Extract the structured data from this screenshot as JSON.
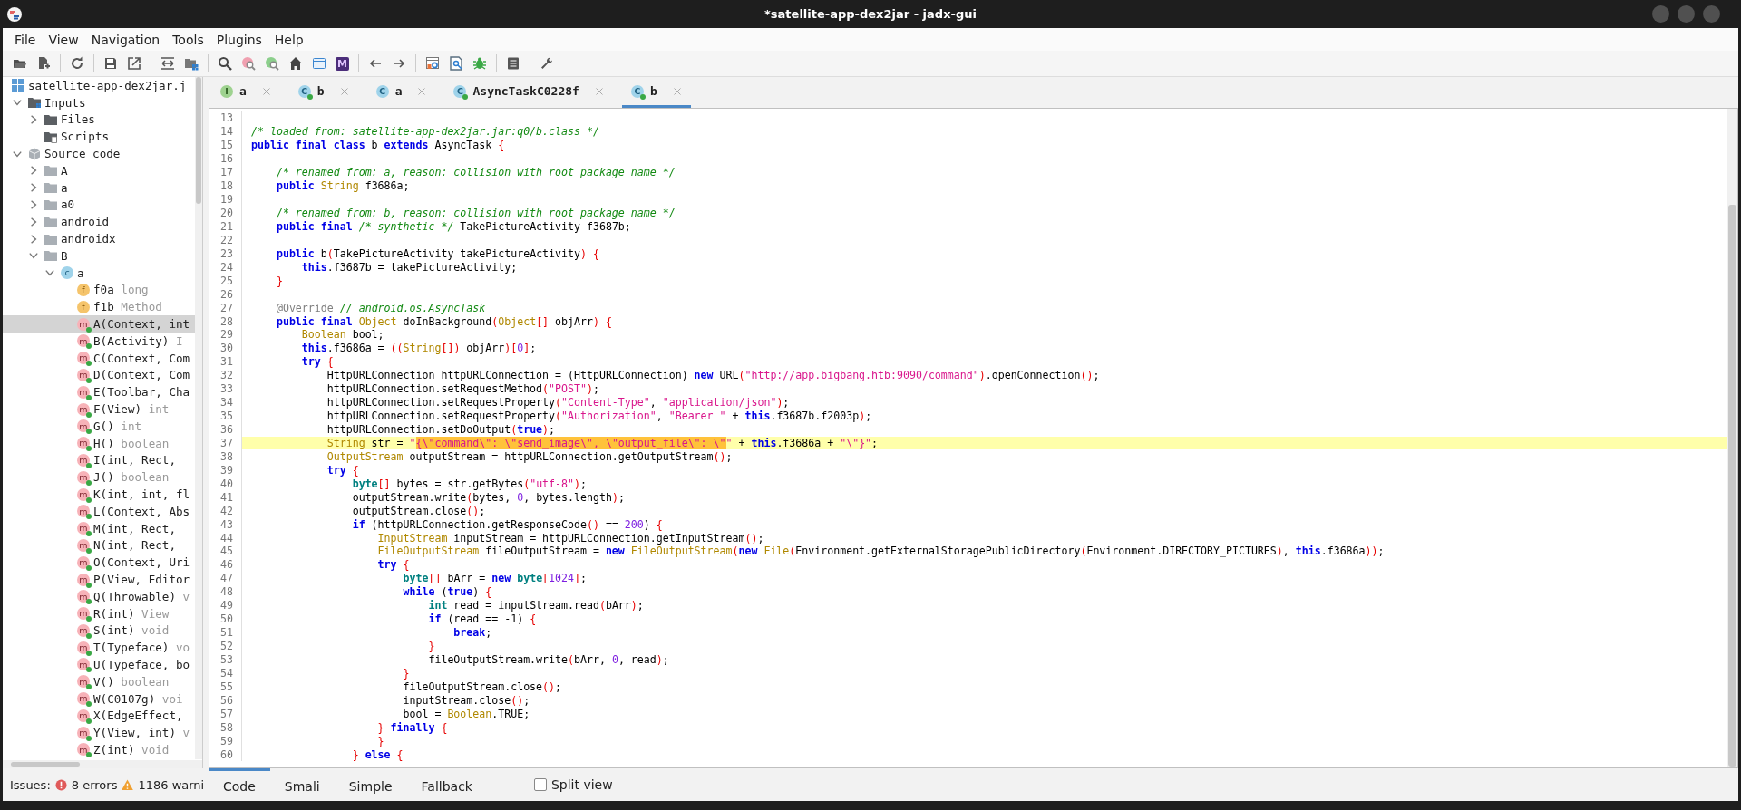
{
  "window": {
    "title": "*satellite-app-dex2jar - jadx-gui"
  },
  "menu": [
    "File",
    "View",
    "Navigation",
    "Tools",
    "Plugins",
    "Help"
  ],
  "toolbar": {
    "mnemonic": "M"
  },
  "tree": [
    {
      "label": "satellite-app-dex2jar.j",
      "kind": "root",
      "selected": false,
      "children": [
        {
          "label": "Inputs",
          "kind": "inputs",
          "expanded": true,
          "selected": false,
          "children": [
            {
              "label": "Files",
              "kind": "folder",
              "expanded": false,
              "selected": false
            },
            {
              "label": "Scripts",
              "kind": "scripts",
              "selected": false
            }
          ]
        },
        {
          "label": "Source code",
          "kind": "source",
          "expanded": true,
          "selected": false,
          "children": [
            {
              "label": "A",
              "kind": "package",
              "expanded": false,
              "selected": false
            },
            {
              "label": "a",
              "kind": "package",
              "expanded": false,
              "selected": false
            },
            {
              "label": "a0",
              "kind": "package",
              "expanded": false,
              "selected": false
            },
            {
              "label": "android",
              "kind": "package",
              "expanded": false,
              "selected": false
            },
            {
              "label": "androidx",
              "kind": "package",
              "expanded": false,
              "selected": false
            },
            {
              "label": "B",
              "kind": "package",
              "expanded": true,
              "selected": false,
              "children": [
                {
                  "label": "a",
                  "kind": "class",
                  "badge": "c",
                  "expanded": true,
                  "selected": false,
                  "children": [
                    {
                      "label": "f0a",
                      "detail": "long",
                      "kind": "field",
                      "badge": "f",
                      "selected": false
                    },
                    {
                      "label": "f1b",
                      "detail": "Method",
                      "kind": "field",
                      "badge": "f",
                      "selected": false
                    },
                    {
                      "label": "A(Context, int",
                      "kind": "method",
                      "badge": "m",
                      "selected": true
                    },
                    {
                      "label": "B(Activity)",
                      "detail": "I",
                      "kind": "method",
                      "badge": "m",
                      "selected": false
                    },
                    {
                      "label": "C(Context, Com",
                      "kind": "method",
                      "badge": "m",
                      "selected": false
                    },
                    {
                      "label": "D(Context, Com",
                      "kind": "method",
                      "badge": "m",
                      "selected": false
                    },
                    {
                      "label": "E(Toolbar, Cha",
                      "kind": "method",
                      "badge": "m",
                      "selected": false
                    },
                    {
                      "label": "F(View)",
                      "detail": "int",
                      "kind": "method",
                      "badge": "m",
                      "selected": false
                    },
                    {
                      "label": "G()",
                      "detail": "int",
                      "kind": "method",
                      "badge": "m",
                      "selected": false
                    },
                    {
                      "label": "H()",
                      "detail": "boolean",
                      "kind": "method",
                      "badge": "m",
                      "selected": false
                    },
                    {
                      "label": "I(int, Rect,",
                      "kind": "method",
                      "badge": "m",
                      "selected": false
                    },
                    {
                      "label": "J()",
                      "detail": "boolean",
                      "kind": "method",
                      "badge": "m",
                      "selected": false
                    },
                    {
                      "label": "K(int, int, fl",
                      "kind": "method",
                      "badge": "m",
                      "selected": false
                    },
                    {
                      "label": "L(Context, Abs",
                      "kind": "method",
                      "badge": "m",
                      "selected": false
                    },
                    {
                      "label": "M(int, Rect,",
                      "kind": "method",
                      "badge": "m",
                      "selected": false
                    },
                    {
                      "label": "N(int, Rect,",
                      "kind": "method",
                      "badge": "m",
                      "selected": false
                    },
                    {
                      "label": "O(Context, Uri",
                      "kind": "method",
                      "badge": "m",
                      "selected": false
                    },
                    {
                      "label": "P(View, Editor",
                      "kind": "method",
                      "badge": "m",
                      "selected": false
                    },
                    {
                      "label": "Q(Throwable)",
                      "detail": "v",
                      "kind": "method",
                      "badge": "m",
                      "selected": false
                    },
                    {
                      "label": "R(int)",
                      "detail": "View",
                      "kind": "method",
                      "badge": "m",
                      "selected": false
                    },
                    {
                      "label": "S(int)",
                      "detail": "void",
                      "kind": "method",
                      "badge": "m",
                      "selected": false
                    },
                    {
                      "label": "T(Typeface)",
                      "detail": "vo",
                      "kind": "method",
                      "badge": "m",
                      "selected": false
                    },
                    {
                      "label": "U(Typeface, bo",
                      "kind": "method",
                      "badge": "m",
                      "selected": false
                    },
                    {
                      "label": "V()",
                      "detail": "boolean",
                      "kind": "method",
                      "badge": "m",
                      "selected": false
                    },
                    {
                      "label": "W(C0107g)",
                      "detail": "voi",
                      "kind": "method",
                      "badge": "m",
                      "selected": false
                    },
                    {
                      "label": "X(EdgeEffect,",
                      "kind": "method",
                      "badge": "m",
                      "selected": false
                    },
                    {
                      "label": "Y(View, int)",
                      "detail": "v",
                      "kind": "method",
                      "badge": "m",
                      "selected": false
                    },
                    {
                      "label": "Z(int)",
                      "detail": "void",
                      "kind": "method",
                      "badge": "m",
                      "selected": false
                    }
                  ]
                }
              ]
            }
          ]
        }
      ]
    }
  ],
  "tabs": [
    {
      "label": "a",
      "kind": "interface",
      "badge": "I",
      "selected": false
    },
    {
      "label": "b",
      "kind": "class-public",
      "badge": "C",
      "selected": false
    },
    {
      "label": "a",
      "kind": "class",
      "badge": "C",
      "selected": false
    },
    {
      "label": "AsyncTaskC0228f",
      "kind": "class-public",
      "badge": "C",
      "selected": false
    },
    {
      "label": "b",
      "kind": "class-public",
      "badge": "C",
      "selected": true
    }
  ],
  "editor": {
    "lines": [
      {
        "num": "13",
        "highlighted": false
      },
      {
        "num": "14",
        "highlighted": false,
        "tokens": [
          {
            "kind": "comment",
            "text": "/* loaded from: satellite-app-dex2jar.jar:q0/b.class */"
          }
        ]
      },
      {
        "num": "15",
        "highlighted": false,
        "tokens": [
          {
            "kind": "keyword",
            "text": "public final class"
          },
          {
            "kind": "plain",
            "text": " b "
          },
          {
            "kind": "keyword",
            "text": "extends"
          },
          {
            "kind": "plain",
            "text": " AsyncTask "
          },
          {
            "kind": "brace",
            "text": "{"
          }
        ]
      },
      {
        "num": "16",
        "highlighted": false
      },
      {
        "num": "17",
        "highlighted": false,
        "tokens": [
          {
            "kind": "comment",
            "text": "    /* renamed from: a, reason: collision with root package name */"
          }
        ]
      },
      {
        "num": "18",
        "highlighted": false,
        "tokens": [
          {
            "kind": "keyword",
            "text": "    public "
          },
          {
            "kind": "type",
            "text": "String"
          },
          {
            "kind": "plain",
            "text": " f3686a;"
          }
        ]
      },
      {
        "num": "19",
        "highlighted": false
      },
      {
        "num": "20",
        "highlighted": false,
        "tokens": [
          {
            "kind": "comment",
            "text": "    /* renamed from: b, reason: collision with root package name */"
          }
        ]
      },
      {
        "num": "21",
        "highlighted": false,
        "tokens": [
          {
            "kind": "keyword",
            "text": "    public final "
          },
          {
            "kind": "comment",
            "text": "/* synthetic */"
          },
          {
            "kind": "plain",
            "text": " TakePictureActivity f3687b;"
          }
        ]
      },
      {
        "num": "22",
        "highlighted": false
      },
      {
        "num": "23",
        "highlighted": false,
        "tokens": [
          {
            "kind": "keyword",
            "text": "    public"
          },
          {
            "kind": "plain",
            "text": " b"
          },
          {
            "kind": "brace",
            "text": "("
          },
          {
            "kind": "plain",
            "text": "TakePictureActivity takePictureActivity"
          },
          {
            "kind": "brace",
            "text": ") {"
          }
        ]
      },
      {
        "num": "24",
        "highlighted": false,
        "tokens": [
          {
            "kind": "keyword",
            "text": "        this"
          },
          {
            "kind": "plain",
            "text": ".f3687b = takePictureActivity;"
          }
        ]
      },
      {
        "num": "25",
        "highlighted": false,
        "tokens": [
          {
            "kind": "brace",
            "text": "    }"
          }
        ]
      },
      {
        "num": "26",
        "highlighted": false
      },
      {
        "num": "27",
        "highlighted": false,
        "tokens": [
          {
            "kind": "annotation",
            "text": "    @Override "
          },
          {
            "kind": "comment",
            "text": "// android.os.AsyncTask"
          }
        ]
      },
      {
        "num": "28",
        "highlighted": false,
        "tokens": [
          {
            "kind": "keyword",
            "text": "    public final "
          },
          {
            "kind": "type",
            "text": "Object"
          },
          {
            "kind": "plain",
            "text": " doInBackground"
          },
          {
            "kind": "brace",
            "text": "("
          },
          {
            "kind": "type",
            "text": "Object"
          },
          {
            "kind": "brace",
            "text": "[]"
          },
          {
            "kind": "plain",
            "text": " objArr"
          },
          {
            "kind": "brace",
            "text": ") {"
          }
        ]
      },
      {
        "num": "29",
        "highlighted": false,
        "tokens": [
          {
            "kind": "type",
            "text": "        Boolean"
          },
          {
            "kind": "plain",
            "text": " bool;"
          }
        ]
      },
      {
        "num": "30",
        "highlighted": false,
        "tokens": [
          {
            "kind": "keyword",
            "text": "        this"
          },
          {
            "kind": "plain",
            "text": ".f3686a = "
          },
          {
            "kind": "brace",
            "text": "(("
          },
          {
            "kind": "type",
            "text": "String"
          },
          {
            "kind": "brace",
            "text": "[])"
          },
          {
            "kind": "plain",
            "text": " objArr"
          },
          {
            "kind": "brace",
            "text": ")["
          },
          {
            "kind": "number",
            "text": "0"
          },
          {
            "kind": "brace",
            "text": "]"
          },
          {
            "kind": "plain",
            "text": ";"
          }
        ]
      },
      {
        "num": "31",
        "highlighted": false,
        "tokens": [
          {
            "kind": "keyword",
            "text": "        try "
          },
          {
            "kind": "brace",
            "text": "{"
          }
        ]
      },
      {
        "num": "32",
        "highlighted": false,
        "tokens": [
          {
            "kind": "plain",
            "text": "            HttpURLConnection httpURLConnection = (HttpURLConnection) "
          },
          {
            "kind": "keyword",
            "text": "new"
          },
          {
            "kind": "plain",
            "text": " URL"
          },
          {
            "kind": "brace",
            "text": "("
          },
          {
            "kind": "string",
            "text": "\"http://app.bigbang.htb:9090/command\""
          },
          {
            "kind": "brace",
            "text": ")"
          },
          {
            "kind": "plain",
            "text": ".openConnection"
          },
          {
            "kind": "brace",
            "text": "()"
          },
          {
            "kind": "plain",
            "text": ";"
          }
        ]
      },
      {
        "num": "33",
        "highlighted": false,
        "tokens": [
          {
            "kind": "plain",
            "text": "            httpURLConnection.setRequestMethod"
          },
          {
            "kind": "brace",
            "text": "("
          },
          {
            "kind": "string",
            "text": "\"POST\""
          },
          {
            "kind": "brace",
            "text": ")"
          },
          {
            "kind": "plain",
            "text": ";"
          }
        ]
      },
      {
        "num": "34",
        "highlighted": false,
        "tokens": [
          {
            "kind": "plain",
            "text": "            httpURLConnection.setRequestProperty"
          },
          {
            "kind": "brace",
            "text": "("
          },
          {
            "kind": "string",
            "text": "\"Content-Type\""
          },
          {
            "kind": "plain",
            "text": ", "
          },
          {
            "kind": "string",
            "text": "\"application/json\""
          },
          {
            "kind": "brace",
            "text": ")"
          },
          {
            "kind": "plain",
            "text": ";"
          }
        ]
      },
      {
        "num": "35",
        "highlighted": false,
        "tokens": [
          {
            "kind": "plain",
            "text": "            httpURLConnection.setRequestProperty"
          },
          {
            "kind": "brace",
            "text": "("
          },
          {
            "kind": "string",
            "text": "\"Authorization\""
          },
          {
            "kind": "plain",
            "text": ", "
          },
          {
            "kind": "string",
            "text": "\"Bearer \""
          },
          {
            "kind": "plain",
            "text": " + "
          },
          {
            "kind": "keyword",
            "text": "this"
          },
          {
            "kind": "plain",
            "text": ".f3687b.f2003p"
          },
          {
            "kind": "brace",
            "text": ")"
          },
          {
            "kind": "plain",
            "text": ";"
          }
        ]
      },
      {
        "num": "36",
        "highlighted": false,
        "tokens": [
          {
            "kind": "plain",
            "text": "            httpURLConnection.setDoOutput"
          },
          {
            "kind": "brace",
            "text": "("
          },
          {
            "kind": "keyword",
            "text": "true"
          },
          {
            "kind": "brace",
            "text": ")"
          },
          {
            "kind": "plain",
            "text": ";"
          }
        ]
      },
      {
        "num": "37",
        "highlighted": true,
        "tokens": [
          {
            "kind": "type",
            "text": "            String"
          },
          {
            "kind": "plain",
            "text": " str = "
          },
          {
            "kind": "string",
            "text": "\""
          },
          {
            "kind": "match",
            "text": "{\\\"command\\\": \\\"send_image\\\", \\\"output_file\\\": \\\""
          },
          {
            "kind": "string",
            "text": "\""
          },
          {
            "kind": "plain",
            "text": " + "
          },
          {
            "kind": "keyword",
            "text": "this"
          },
          {
            "kind": "plain",
            "text": ".f3686a + "
          },
          {
            "kind": "string",
            "text": "\"\\\"}\""
          },
          {
            "kind": "plain",
            "text": ";"
          }
        ]
      },
      {
        "num": "38",
        "highlighted": false,
        "tokens": [
          {
            "kind": "type",
            "text": "            OutputStream"
          },
          {
            "kind": "plain",
            "text": " outputStream = httpURLConnection.getOutputStream"
          },
          {
            "kind": "brace",
            "text": "()"
          },
          {
            "kind": "plain",
            "text": ";"
          }
        ]
      },
      {
        "num": "39",
        "highlighted": false,
        "tokens": [
          {
            "kind": "keyword",
            "text": "            try "
          },
          {
            "kind": "brace",
            "text": "{"
          }
        ]
      },
      {
        "num": "40",
        "highlighted": false,
        "tokens": [
          {
            "kind": "primitive",
            "text": "                byte"
          },
          {
            "kind": "brace",
            "text": "[]"
          },
          {
            "kind": "plain",
            "text": " bytes = str.getBytes"
          },
          {
            "kind": "brace",
            "text": "("
          },
          {
            "kind": "string",
            "text": "\"utf-8\""
          },
          {
            "kind": "brace",
            "text": ")"
          },
          {
            "kind": "plain",
            "text": ";"
          }
        ]
      },
      {
        "num": "41",
        "highlighted": false,
        "tokens": [
          {
            "kind": "plain",
            "text": "                outputStream.write"
          },
          {
            "kind": "brace",
            "text": "("
          },
          {
            "kind": "plain",
            "text": "bytes, "
          },
          {
            "kind": "number",
            "text": "0"
          },
          {
            "kind": "plain",
            "text": ", bytes.length"
          },
          {
            "kind": "brace",
            "text": ")"
          },
          {
            "kind": "plain",
            "text": ";"
          }
        ]
      },
      {
        "num": "42",
        "highlighted": false,
        "tokens": [
          {
            "kind": "plain",
            "text": "                outputStream.close"
          },
          {
            "kind": "brace",
            "text": "()"
          },
          {
            "kind": "plain",
            "text": ";"
          }
        ]
      },
      {
        "num": "43",
        "highlighted": false,
        "tokens": [
          {
            "kind": "keyword",
            "text": "                if"
          },
          {
            "kind": "plain",
            "text": " (httpURLConnection.getResponseCode"
          },
          {
            "kind": "brace",
            "text": "()"
          },
          {
            "kind": "plain",
            "text": " == "
          },
          {
            "kind": "number",
            "text": "200"
          },
          {
            "kind": "plain",
            "text": ") "
          },
          {
            "kind": "brace",
            "text": "{"
          }
        ]
      },
      {
        "num": "44",
        "highlighted": false,
        "tokens": [
          {
            "kind": "type",
            "text": "                    InputStream"
          },
          {
            "kind": "plain",
            "text": " inputStream = httpURLConnection.getInputStream"
          },
          {
            "kind": "brace",
            "text": "()"
          },
          {
            "kind": "plain",
            "text": ";"
          }
        ]
      },
      {
        "num": "45",
        "highlighted": false,
        "tokens": [
          {
            "kind": "type",
            "text": "                    FileOutputStream"
          },
          {
            "kind": "plain",
            "text": " fileOutputStream = "
          },
          {
            "kind": "keyword",
            "text": "new "
          },
          {
            "kind": "type",
            "text": "FileOutputStream"
          },
          {
            "kind": "brace",
            "text": "("
          },
          {
            "kind": "keyword",
            "text": "new "
          },
          {
            "kind": "type",
            "text": "File"
          },
          {
            "kind": "brace",
            "text": "("
          },
          {
            "kind": "plain",
            "text": "Environment.getExternalStoragePublicDirectory"
          },
          {
            "kind": "brace",
            "text": "("
          },
          {
            "kind": "plain",
            "text": "Environment.DIRECTORY_PICTURES"
          },
          {
            "kind": "brace",
            "text": ")"
          },
          {
            "kind": "plain",
            "text": ", "
          },
          {
            "kind": "keyword",
            "text": "this"
          },
          {
            "kind": "plain",
            "text": ".f3686a"
          },
          {
            "kind": "brace",
            "text": "))"
          },
          {
            "kind": "plain",
            "text": ";"
          }
        ]
      },
      {
        "num": "46",
        "highlighted": false,
        "tokens": [
          {
            "kind": "keyword",
            "text": "                    try "
          },
          {
            "kind": "brace",
            "text": "{"
          }
        ]
      },
      {
        "num": "47",
        "highlighted": false,
        "tokens": [
          {
            "kind": "primitive",
            "text": "                        byte"
          },
          {
            "kind": "brace",
            "text": "[]"
          },
          {
            "kind": "plain",
            "text": " bArr = "
          },
          {
            "kind": "keyword",
            "text": "new "
          },
          {
            "kind": "primitive",
            "text": "byte"
          },
          {
            "kind": "brace",
            "text": "["
          },
          {
            "kind": "number",
            "text": "1024"
          },
          {
            "kind": "brace",
            "text": "]"
          },
          {
            "kind": "plain",
            "text": ";"
          }
        ]
      },
      {
        "num": "48",
        "highlighted": false,
        "tokens": [
          {
            "kind": "keyword",
            "text": "                        while"
          },
          {
            "kind": "plain",
            "text": " ("
          },
          {
            "kind": "keyword",
            "text": "true"
          },
          {
            "kind": "plain",
            "text": ") "
          },
          {
            "kind": "brace",
            "text": "{"
          }
        ]
      },
      {
        "num": "49",
        "highlighted": false,
        "tokens": [
          {
            "kind": "primitive",
            "text": "                            int"
          },
          {
            "kind": "plain",
            "text": " read = inputStream.read"
          },
          {
            "kind": "brace",
            "text": "("
          },
          {
            "kind": "plain",
            "text": "bArr"
          },
          {
            "kind": "brace",
            "text": ")"
          },
          {
            "kind": "plain",
            "text": ";"
          }
        ]
      },
      {
        "num": "50",
        "highlighted": false,
        "tokens": [
          {
            "kind": "keyword",
            "text": "                            if"
          },
          {
            "kind": "plain",
            "text": " (read == -1) "
          },
          {
            "kind": "brace",
            "text": "{"
          }
        ]
      },
      {
        "num": "51",
        "highlighted": false,
        "tokens": [
          {
            "kind": "keyword",
            "text": "                                break"
          },
          {
            "kind": "plain",
            "text": ";"
          }
        ]
      },
      {
        "num": "52",
        "highlighted": false,
        "tokens": [
          {
            "kind": "brace",
            "text": "                            }"
          }
        ]
      },
      {
        "num": "53",
        "highlighted": false,
        "tokens": [
          {
            "kind": "plain",
            "text": "                            fileOutputStream.write"
          },
          {
            "kind": "brace",
            "text": "("
          },
          {
            "kind": "plain",
            "text": "bArr, "
          },
          {
            "kind": "number",
            "text": "0"
          },
          {
            "kind": "plain",
            "text": ", read"
          },
          {
            "kind": "brace",
            "text": ")"
          },
          {
            "kind": "plain",
            "text": ";"
          }
        ]
      },
      {
        "num": "54",
        "highlighted": false,
        "tokens": [
          {
            "kind": "brace",
            "text": "                        }"
          }
        ]
      },
      {
        "num": "55",
        "highlighted": false,
        "tokens": [
          {
            "kind": "plain",
            "text": "                        fileOutputStream.close"
          },
          {
            "kind": "brace",
            "text": "()"
          },
          {
            "kind": "plain",
            "text": ";"
          }
        ]
      },
      {
        "num": "56",
        "highlighted": false,
        "tokens": [
          {
            "kind": "plain",
            "text": "                        inputStream.close"
          },
          {
            "kind": "brace",
            "text": "()"
          },
          {
            "kind": "plain",
            "text": ";"
          }
        ]
      },
      {
        "num": "57",
        "highlighted": false,
        "tokens": [
          {
            "kind": "plain",
            "text": "                        bool = "
          },
          {
            "kind": "type",
            "text": "Boolean"
          },
          {
            "kind": "plain",
            "text": ".TRUE;"
          }
        ]
      },
      {
        "num": "58",
        "highlighted": false,
        "tokens": [
          {
            "kind": "brace",
            "text": "                    } "
          },
          {
            "kind": "keyword",
            "text": "finally "
          },
          {
            "kind": "brace",
            "text": "{"
          }
        ]
      },
      {
        "num": "59",
        "highlighted": false,
        "tokens": [
          {
            "kind": "brace",
            "text": "                    }"
          }
        ]
      },
      {
        "num": "60",
        "highlighted": false,
        "tokens": [
          {
            "kind": "brace",
            "text": "                } "
          },
          {
            "kind": "keyword",
            "text": "else "
          },
          {
            "kind": "brace",
            "text": "{"
          }
        ]
      }
    ]
  },
  "status": {
    "label": "Issues:",
    "errors": "8 errors",
    "warnings": "1186 warni"
  },
  "code_view": {
    "modes": [
      {
        "label": "Code",
        "selected": true
      },
      {
        "label": "Smali",
        "selected": false
      },
      {
        "label": "Simple",
        "selected": false
      },
      {
        "label": "Fallback",
        "selected": false
      }
    ],
    "split_view": {
      "label": "Split view",
      "checked": false
    }
  }
}
